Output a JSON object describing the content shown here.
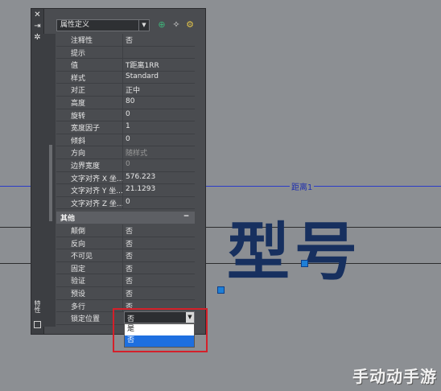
{
  "canvas": {
    "dimension_label": "距离1",
    "text_object": "型号"
  },
  "palette": {
    "title": "特性",
    "type_select": "属性定义",
    "general_rows": [
      {
        "label": "注释性",
        "value": "否"
      },
      {
        "label": "提示",
        "value": ""
      },
      {
        "label": "值",
        "value": "T距离1RR"
      },
      {
        "label": "样式",
        "value": "Standard"
      },
      {
        "label": "对正",
        "value": "正中"
      },
      {
        "label": "高度",
        "value": "80"
      },
      {
        "label": "旋转",
        "value": "0"
      },
      {
        "label": "宽度因子",
        "value": "1"
      },
      {
        "label": "倾斜",
        "value": "0"
      },
      {
        "label": "方向",
        "value": "随样式"
      },
      {
        "label": "边界宽度",
        "value": "0"
      },
      {
        "label": "文字对齐 X 坐...",
        "value": "576.223"
      },
      {
        "label": "文字对齐 Y 坐...",
        "value": "21.1293"
      },
      {
        "label": "文字对齐 Z 坐...",
        "value": "0"
      }
    ],
    "category_other": "其他",
    "other_rows": [
      {
        "label": "颠倒",
        "value": "否"
      },
      {
        "label": "反向",
        "value": "否"
      },
      {
        "label": "不可见",
        "value": "否"
      },
      {
        "label": "固定",
        "value": "否"
      },
      {
        "label": "验证",
        "value": "否"
      },
      {
        "label": "预设",
        "value": "否"
      },
      {
        "label": "多行",
        "value": "否"
      }
    ],
    "lock_position": {
      "label": "锁定位置",
      "value": "否",
      "options": [
        "是",
        "否"
      ],
      "selected": "否"
    }
  },
  "watermark": "手动动手游",
  "colors": {
    "canvas_bg": "#8c8f93",
    "palette_bg": "#4a4c50",
    "dimension_line": "#2a3cc8",
    "text_object": "#17305f",
    "grip": "#1e7fd6",
    "selection": "#1e6fe0",
    "highlight_box": "#d4202a"
  },
  "icons": {
    "close": "close-icon",
    "autohide": "autohide-icon",
    "options": "options-icon",
    "quick_select": "quick-select-icon",
    "select_objects": "select-objects-icon",
    "pickadd": "pickadd-icon"
  }
}
